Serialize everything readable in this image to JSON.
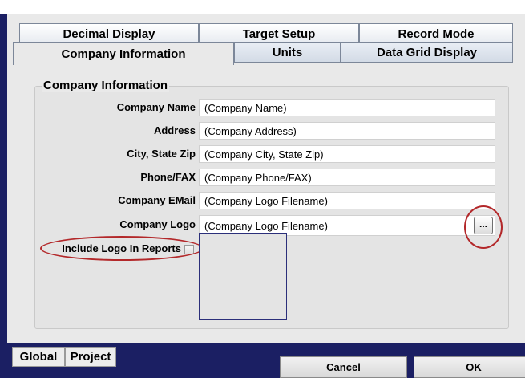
{
  "tabs_row1": [
    "Decimal Display",
    "Target Setup",
    "Record Mode"
  ],
  "tabs_row2": [
    "Company Information",
    "Units",
    "Data Grid Display"
  ],
  "group_title": "Company Information",
  "fields": [
    {
      "label": "Company Name",
      "value": "(Company Name)"
    },
    {
      "label": "Address",
      "value": "(Company Address)"
    },
    {
      "label": "City, State Zip",
      "value": "(Company City, State Zip)"
    },
    {
      "label": "Phone/FAX",
      "value": "(Company Phone/FAX)"
    },
    {
      "label": "Company EMail",
      "value": "(Company Logo Filename)"
    },
    {
      "label": "Company Logo",
      "value": "(Company Logo Filename)"
    }
  ],
  "browse_label": "...",
  "include_logo_label": "Include Logo In Reports",
  "bottom_tabs": [
    "Global",
    "Project"
  ],
  "buttons": {
    "cancel": "Cancel",
    "ok": "OK"
  },
  "colors": {
    "background": "#1b1f63",
    "panel": "#e9e9e9",
    "callout": "#b3282a"
  }
}
